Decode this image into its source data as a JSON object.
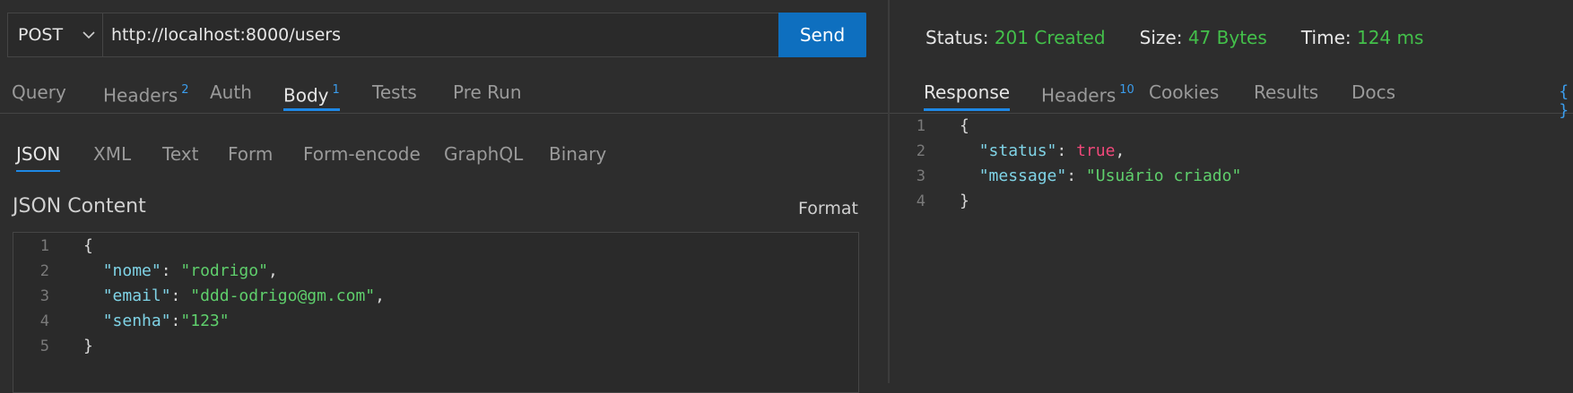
{
  "request": {
    "method": "POST",
    "url": "http://localhost:8000/users",
    "send_label": "Send"
  },
  "request_tabs": [
    {
      "label": "Query",
      "badge": null
    },
    {
      "label": "Headers",
      "badge": "2"
    },
    {
      "label": "Auth",
      "badge": null
    },
    {
      "label": "Body",
      "badge": "1",
      "active": true
    },
    {
      "label": "Tests",
      "badge": null
    },
    {
      "label": "Pre Run",
      "badge": null
    }
  ],
  "body_tabs": [
    {
      "label": "JSON",
      "active": true
    },
    {
      "label": "XML"
    },
    {
      "label": "Text"
    },
    {
      "label": "Form"
    },
    {
      "label": "Form-encode"
    },
    {
      "label": "GraphQL"
    },
    {
      "label": "Binary"
    }
  ],
  "json_content": {
    "title": "JSON Content",
    "format_label": "Format",
    "lines": [
      {
        "n": "1",
        "parts": [
          {
            "t": "{",
            "c": "punc"
          }
        ]
      },
      {
        "n": "2",
        "parts": [
          {
            "t": "  ",
            "c": "punc"
          },
          {
            "t": "\"nome\"",
            "c": "key"
          },
          {
            "t": ": ",
            "c": "punc"
          },
          {
            "t": "\"rodrigo\"",
            "c": "str"
          },
          {
            "t": ",",
            "c": "punc"
          }
        ]
      },
      {
        "n": "3",
        "parts": [
          {
            "t": "  ",
            "c": "punc"
          },
          {
            "t": "\"email\"",
            "c": "key"
          },
          {
            "t": ": ",
            "c": "punc"
          },
          {
            "t": "\"ddd-odrigo@gm.com\"",
            "c": "str"
          },
          {
            "t": ",",
            "c": "punc"
          }
        ]
      },
      {
        "n": "4",
        "parts": [
          {
            "t": "  ",
            "c": "punc"
          },
          {
            "t": "\"senha\"",
            "c": "key"
          },
          {
            "t": ":",
            "c": "punc"
          },
          {
            "t": "\"123\"",
            "c": "str"
          }
        ]
      },
      {
        "n": "5",
        "parts": [
          {
            "t": "}",
            "c": "punc"
          }
        ]
      }
    ]
  },
  "response_status": {
    "status_label": "Status:",
    "status_value": "201 Created",
    "size_label": "Size:",
    "size_value": "47 Bytes",
    "time_label": "Time:",
    "time_value": "124 ms"
  },
  "response_tabs": [
    {
      "label": "Response",
      "active": true,
      "badge": null
    },
    {
      "label": "Headers",
      "badge": "10"
    },
    {
      "label": "Cookies",
      "badge": null
    },
    {
      "label": "Results",
      "badge": null
    },
    {
      "label": "Docs",
      "badge": null
    }
  ],
  "corner_label": "{ }",
  "response_body": {
    "lines": [
      {
        "n": "1",
        "parts": [
          {
            "t": "{",
            "c": "punc"
          }
        ]
      },
      {
        "n": "2",
        "parts": [
          {
            "t": "  ",
            "c": "punc"
          },
          {
            "t": "\"status\"",
            "c": "key"
          },
          {
            "t": ": ",
            "c": "punc"
          },
          {
            "t": "true",
            "c": "bool"
          },
          {
            "t": ",",
            "c": "punc"
          }
        ]
      },
      {
        "n": "3",
        "parts": [
          {
            "t": "  ",
            "c": "punc"
          },
          {
            "t": "\"message\"",
            "c": "key"
          },
          {
            "t": ": ",
            "c": "punc"
          },
          {
            "t": "\"Usuário criado\"",
            "c": "str"
          }
        ]
      },
      {
        "n": "4",
        "parts": [
          {
            "t": "}",
            "c": "punc"
          }
        ]
      }
    ]
  },
  "colors": {
    "accent": "#1e88e5",
    "send_bg": "#0e6fbf",
    "success": "#43c04a",
    "background": "#2d2d2d"
  }
}
